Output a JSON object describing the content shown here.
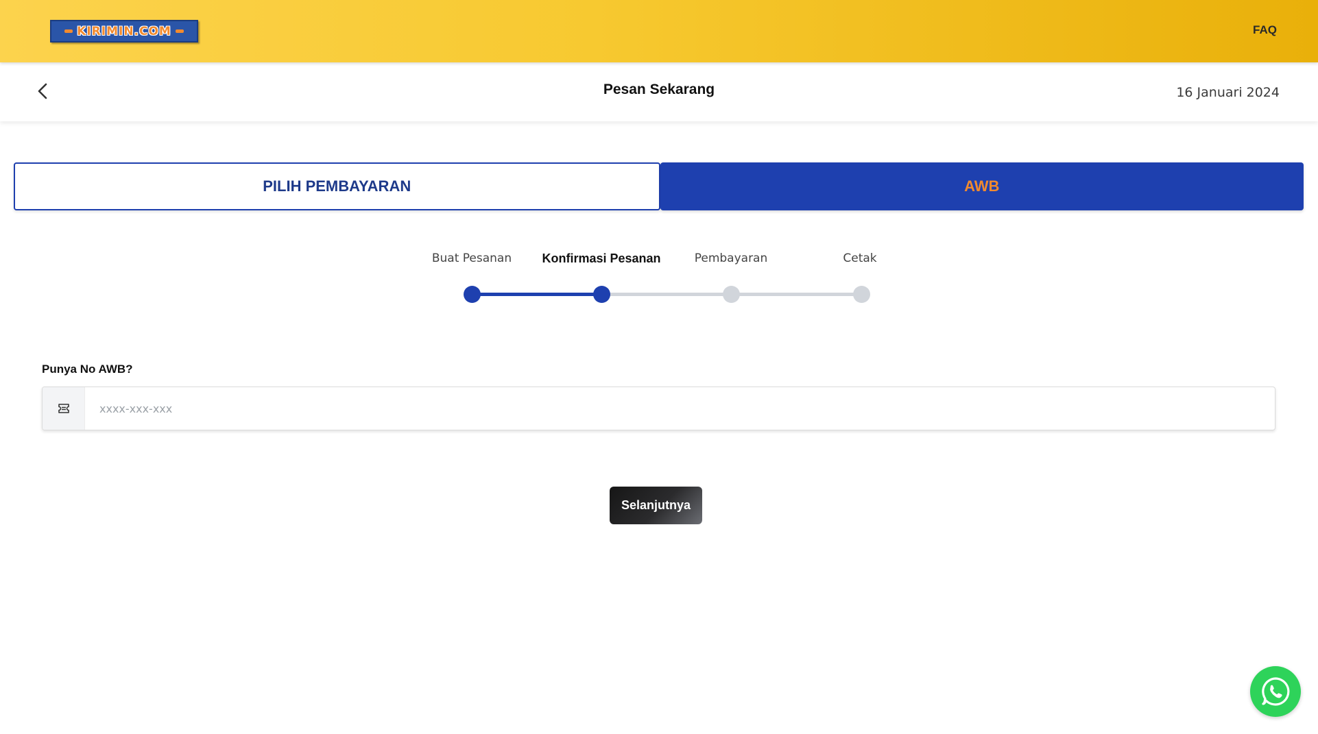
{
  "header": {
    "logo_text": "KIRIMIN.COM",
    "faq_label": "FAQ"
  },
  "subheader": {
    "title": "Pesan Sekarang",
    "date": "16 Januari 2024",
    "back_icon": "chevron-left-icon"
  },
  "tabs": [
    {
      "label": "PILIH PEMBAYARAN",
      "selected": false
    },
    {
      "label": "AWB",
      "selected": true
    }
  ],
  "stepper": {
    "steps": [
      {
        "label": "Buat Pesanan",
        "state": "done"
      },
      {
        "label": "Konfirmasi Pesanan",
        "state": "current"
      },
      {
        "label": "Pembayaran",
        "state": "pending"
      },
      {
        "label": "Cetak",
        "state": "pending"
      }
    ]
  },
  "awb": {
    "label": "Punya No AWB?",
    "placeholder": "xxxx-xxx-xxx",
    "value": "",
    "icon": "ticket-icon"
  },
  "actions": {
    "next_label": "Selanjutnya"
  },
  "floating": {
    "whatsapp_icon": "whatsapp-icon"
  },
  "colors": {
    "primary_blue": "#1e40af",
    "accent_orange": "#f28a2e",
    "header_yellow": "#f7c930",
    "whatsapp_green": "#2ed35a",
    "inactive_gray": "#d1d5db"
  }
}
